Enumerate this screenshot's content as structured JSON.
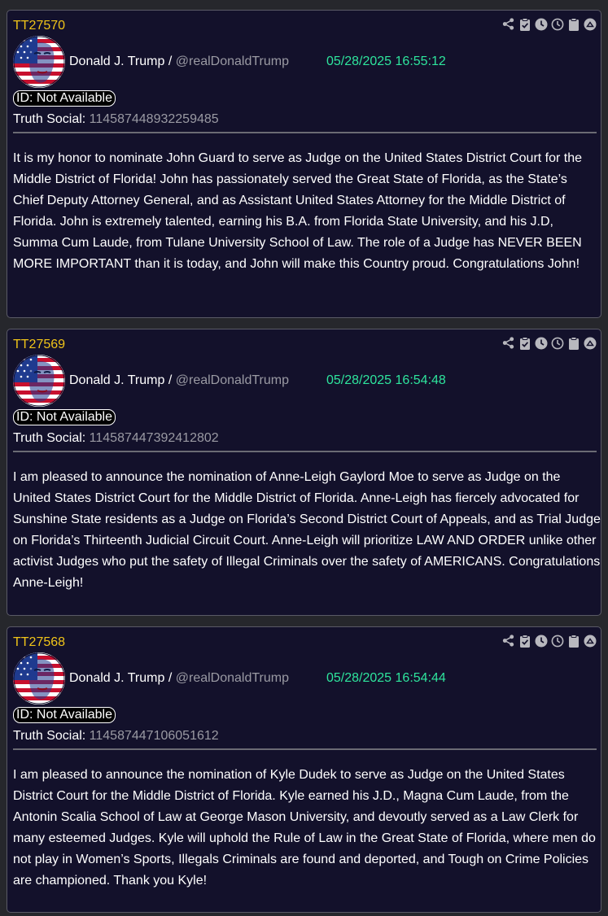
{
  "posts": [
    {
      "id": "TT27570",
      "author_name": "Donald J. Trump",
      "separator": "/",
      "handle": "@realDonaldTrump",
      "timestamp": "05/28/2025 16:55:12",
      "id_badge": "ID: Not Available",
      "source_label": "Truth Social:",
      "source_id": "114587448932259485",
      "text": "It is my honor to nominate John Guard to serve as Judge on the United States District Court for the Middle District of Florida! John has passionately served the Great State of Florida, as the State’s Chief Deputy Attorney General, and as Assistant United States Attorney for the Middle District of Florida. John is extremely talented, earning his B.A. from Florida State University, and his J.D, Summa Cum Laude, from Tulane University School of Law. The role of a Judge has NEVER BEEN MORE IMPORTANT than it is today, and John will make this Country proud. Congratulations John!"
    },
    {
      "id": "TT27569",
      "author_name": "Donald J. Trump",
      "separator": "/",
      "handle": "@realDonaldTrump",
      "timestamp": "05/28/2025 16:54:48",
      "id_badge": "ID: Not Available",
      "source_label": "Truth Social:",
      "source_id": "114587447392412802",
      "text": "I am pleased to announce the nomination of Anne-Leigh Gaylord Moe to serve as Judge on the United States District Court for the Middle District of Florida. Anne-Leigh has fiercely advocated for Sunshine State residents as a Judge on Florida’s Second District Court of Appeals, and as Trial Judge on Florida’s Thirteenth Judicial Circuit Court. Anne-Leigh will prioritize LAW AND ORDER unlike other activist Judges who put the safety of Illegal Criminals over the safety of AMERICANS. Congratulations Anne-Leigh!"
    },
    {
      "id": "TT27568",
      "author_name": "Donald J. Trump",
      "separator": "/",
      "handle": "@realDonaldTrump",
      "timestamp": "05/28/2025 16:54:44",
      "id_badge": "ID: Not Available",
      "source_label": "Truth Social:",
      "source_id": "114587447106051612",
      "text": "I am pleased to announce the nomination of Kyle Dudek to serve as Judge on the United States District Court for the Middle District of Florida. Kyle earned his J.D., Magna Cum Laude, from the Antonin Scalia School of Law at George Mason University, and devoutly served as a Law Clerk for many esteemed Judges. Kyle will uphold the Rule of Law in the Great State of Florida, where men do not play in Women’s Sports, Illegals Criminals are found and deported, and Tough on Crime Policies are championed. Thank you Kyle!"
    }
  ],
  "toolbar_icons": [
    "share-icon",
    "clipboard-check-icon",
    "clock-filled-icon",
    "clock-outline-icon",
    "clipboard-icon",
    "circle-up-icon"
  ],
  "colors": {
    "page_background": "#26272c",
    "card_background": "#13112b",
    "card_border": "#5a5a66",
    "post_id": "#f0c419",
    "timestamp": "#2ee59d",
    "muted_text": "#9a9aa3",
    "icon": "#b8b8be"
  }
}
